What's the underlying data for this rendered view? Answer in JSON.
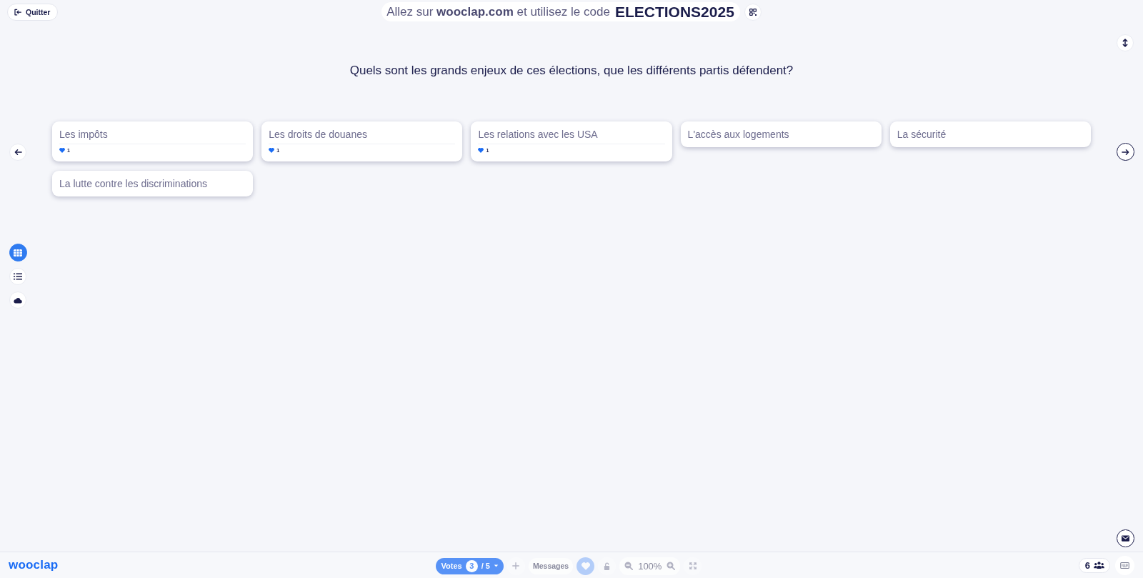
{
  "quit_button": {
    "label": "Quitter"
  },
  "join_banner": {
    "text": "Allez sur **wooclap.com** et utilisez le code",
    "code": "ELECTIONS2025"
  },
  "question": "Quels sont les grands enjeux de ces élections, que les différents partis défendent?",
  "views": [
    {
      "kind": "grid",
      "selected": true
    },
    {
      "kind": "list",
      "selected": false
    },
    {
      "kind": "cloud",
      "selected": false
    }
  ],
  "answers": [
    {
      "text": "Les impôts",
      "votes": "1"
    },
    {
      "text": "Les droits de douanes",
      "votes": "1"
    },
    {
      "text": "Les relations avec les USA",
      "votes": "1"
    },
    {
      "text": "L'accès aux logements"
    },
    {
      "text": "La sécurité"
    },
    {
      "text": "La lutte contre les discriminations"
    }
  ],
  "bottom_bar": {
    "logo": "wooclap",
    "controls": [
      {
        "kind": "votes",
        "label": "Votes",
        "current": "3",
        "total": "/ 5",
        "disabled": true
      },
      {
        "kind": "add",
        "disabled": true
      },
      {
        "kind": "messages",
        "label": "Messages",
        "disabled": true
      },
      {
        "kind": "likes",
        "on": true,
        "disabled": true
      },
      {
        "kind": "lock",
        "disabled": true
      },
      {
        "kind": "zoom",
        "value": "100%",
        "disabled": true
      },
      {
        "kind": "fullscreen",
        "disabled": true
      }
    ],
    "participants": "6"
  }
}
